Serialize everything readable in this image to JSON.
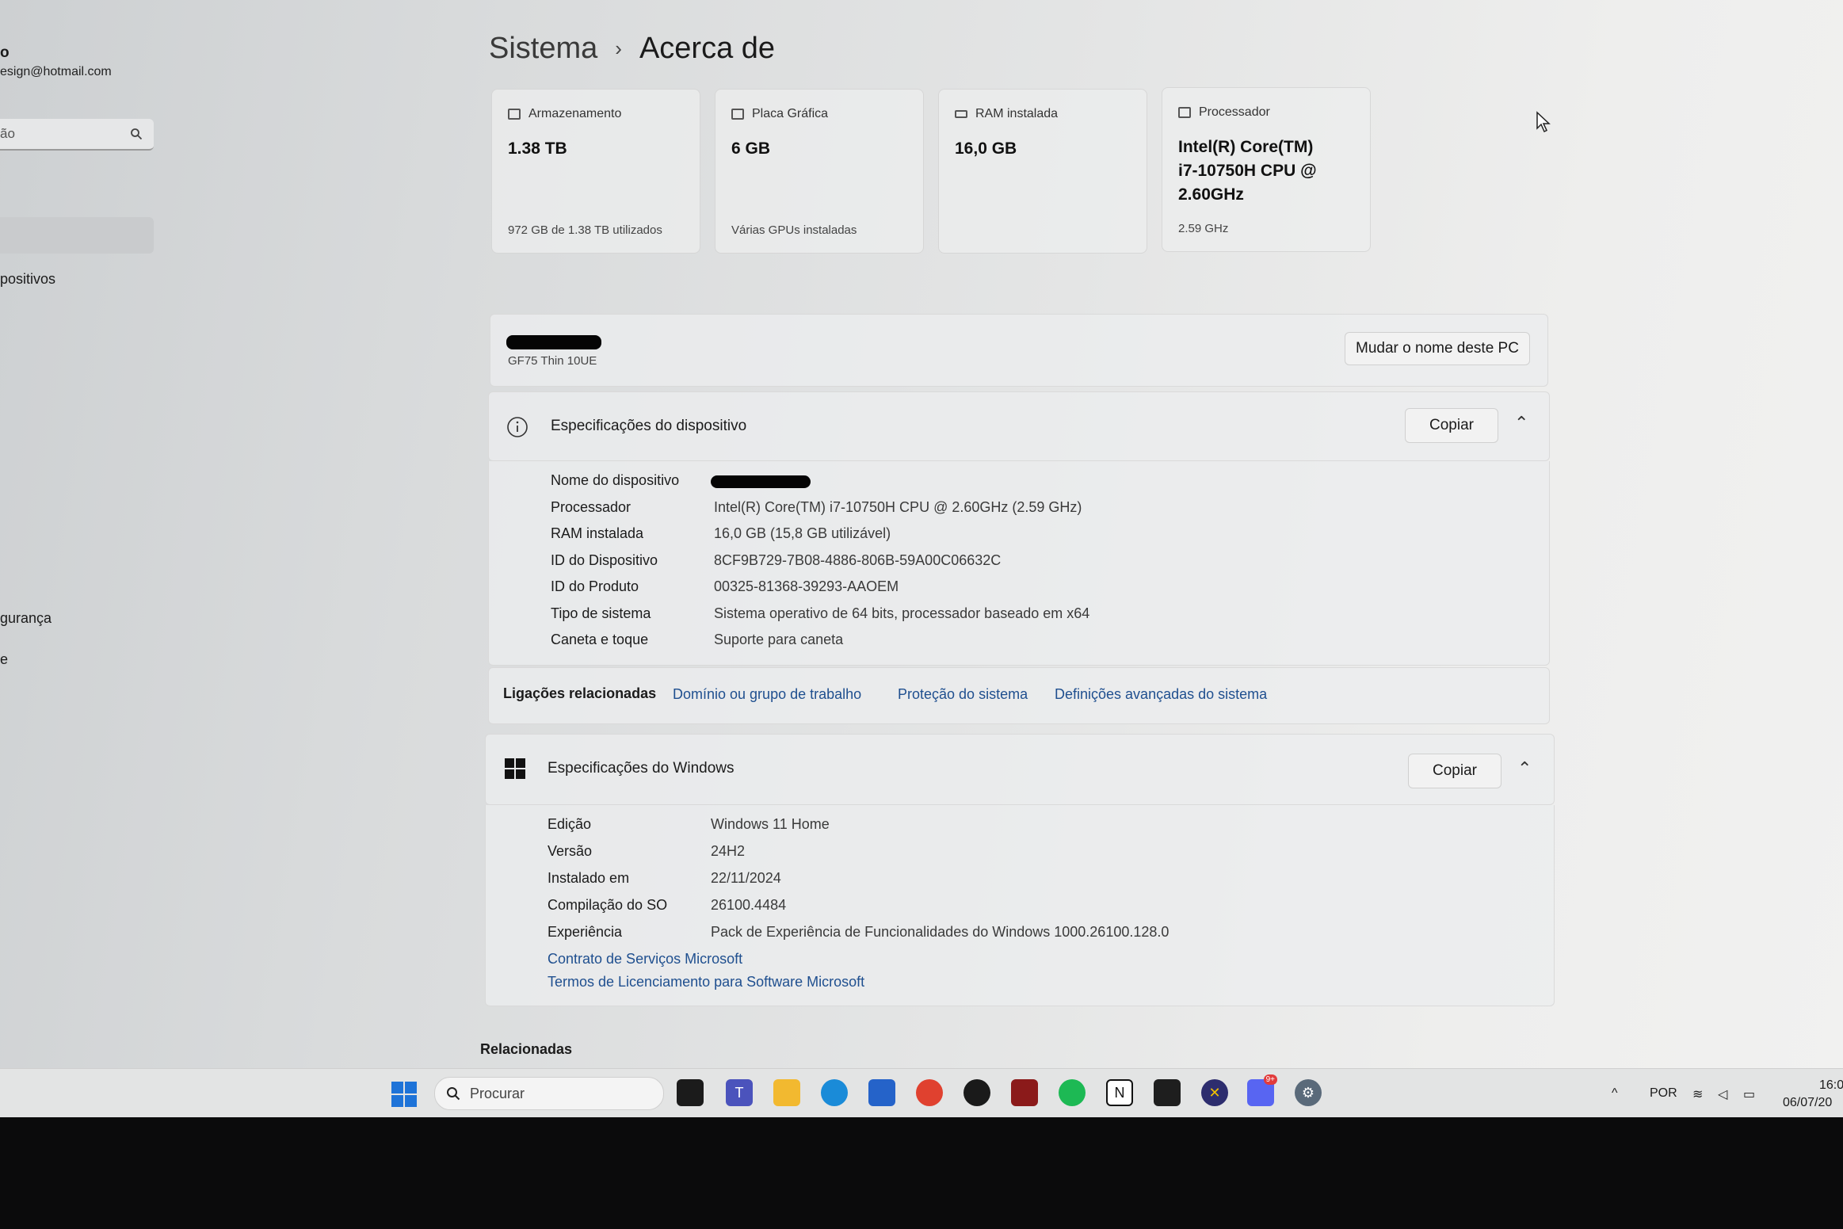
{
  "sidebar": {
    "user_name": "o",
    "email": "esign@hotmail.com",
    "search_placeholder": "ão",
    "items": [
      {
        "label": "positivos"
      },
      {
        "label": "gurança"
      },
      {
        "label": "e"
      }
    ]
  },
  "header": {
    "root": "Sistema",
    "current": "Acerca de"
  },
  "cards": [
    {
      "title": "Armazenamento",
      "value": "1.38 TB",
      "sub": "972 GB de 1.38 TB utilizados"
    },
    {
      "title": "Placa Gráfica",
      "value": "6 GB",
      "sub": "Várias GPUs instaladas"
    },
    {
      "title": "RAM instalada",
      "value": "16,0 GB",
      "sub": ""
    },
    {
      "title": "Processador",
      "value": "Intel(R) Core(TM) i7-10750H CPU @ 2.60GHz",
      "sub": "2.59 GHz"
    }
  ],
  "pc": {
    "model": "GF75 Thin 10UE",
    "rename_button": "Mudar o nome deste PC"
  },
  "device_specs": {
    "title": "Especificações do dispositivo",
    "copy_button": "Copiar",
    "rows": [
      {
        "label": "Nome do dispositivo",
        "value": ""
      },
      {
        "label": "Processador",
        "value": "Intel(R) Core(TM) i7-10750H CPU @ 2.60GHz (2.59 GHz)"
      },
      {
        "label": "RAM instalada",
        "value": "16,0 GB (15,8 GB utilizável)"
      },
      {
        "label": "ID do Dispositivo",
        "value": "8CF9B729-7B08-4886-806B-59A00C06632C"
      },
      {
        "label": "ID do Produto",
        "value": "00325-81368-39293-AAOEM"
      },
      {
        "label": "Tipo de sistema",
        "value": "Sistema operativo de 64 bits, processador baseado em x64"
      },
      {
        "label": "Caneta e toque",
        "value": "Suporte para caneta"
      }
    ]
  },
  "related_links": {
    "label": "Ligações relacionadas",
    "links": [
      "Domínio ou grupo de trabalho",
      "Proteção do sistema",
      "Definições avançadas do sistema"
    ]
  },
  "windows_specs": {
    "title": "Especificações do Windows",
    "copy_button": "Copiar",
    "rows": [
      {
        "label": "Edição",
        "value": "Windows 11 Home"
      },
      {
        "label": "Versão",
        "value": "24H2"
      },
      {
        "label": "Instalado em",
        "value": "22/11/2024"
      },
      {
        "label": "Compilação do SO",
        "value": "26100.4484"
      },
      {
        "label": "Experiência",
        "value": "Pack de Experiência de Funcionalidades do Windows 1000.26100.128.0"
      }
    ],
    "links": [
      "Contrato de Serviços Microsoft",
      "Termos de Licenciamento para Software Microsoft"
    ]
  },
  "related_section": "Relacionadas",
  "taskbar": {
    "search_placeholder": "Procurar",
    "language": "POR",
    "time": "16:0",
    "date": "06/07/20",
    "discord_badge": "9+"
  }
}
